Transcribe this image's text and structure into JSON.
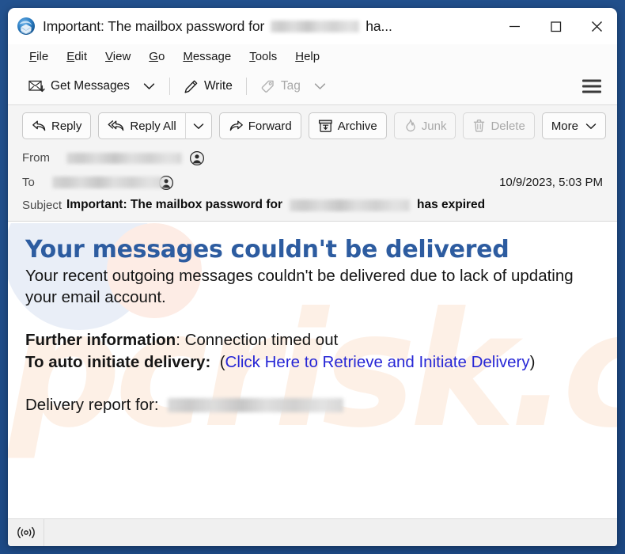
{
  "window": {
    "app_icon": "thunderbird-icon",
    "title_prefix": "Important: The mailbox password for",
    "title_redacted": "[redacted email address]",
    "title_suffix": "ha...",
    "minimize_label": "Minimize",
    "maximize_label": "Maximize",
    "close_label": "Close"
  },
  "menubar": {
    "items": [
      {
        "label": "File",
        "accesskey": "F"
      },
      {
        "label": "Edit",
        "accesskey": "E"
      },
      {
        "label": "View",
        "accesskey": "V"
      },
      {
        "label": "Go",
        "accesskey": "G"
      },
      {
        "label": "Message",
        "accesskey": "M"
      },
      {
        "label": "Tools",
        "accesskey": "T"
      },
      {
        "label": "Help",
        "accesskey": "H"
      }
    ]
  },
  "toolbar": {
    "get_messages_label": "Get Messages",
    "get_messages_icon": "envelope-download-icon",
    "get_messages_dropdown_icon": "chevron-down-icon",
    "write_label": "Write",
    "write_icon": "pencil-icon",
    "tag_label": "Tag",
    "tag_icon": "tag-icon",
    "tag_dropdown_icon": "chevron-down-icon",
    "app_menu_icon": "hamburger-icon"
  },
  "message_actions": {
    "reply_label": "Reply",
    "reply_icon": "reply-arrow-icon",
    "reply_all_label": "Reply All",
    "reply_all_icon": "reply-all-arrow-icon",
    "reply_all_dropdown_icon": "chevron-down-icon",
    "forward_label": "Forward",
    "forward_icon": "forward-arrow-icon",
    "archive_label": "Archive",
    "archive_icon": "archive-box-icon",
    "junk_label": "Junk",
    "junk_icon": "flame-icon",
    "delete_label": "Delete",
    "delete_icon": "trash-icon",
    "more_label": "More",
    "more_dropdown_icon": "chevron-down-icon"
  },
  "headers": {
    "from_label": "From",
    "from_value": "[redacted sender email address]",
    "from_avatar_icon": "contact-avatar-icon",
    "to_label": "To",
    "to_value": "[redacted recipient email address]",
    "to_avatar_icon": "contact-avatar-icon",
    "date": "10/9/2023, 5:03 PM",
    "subject_label": "Subject",
    "subject_prefix": "Important: The mailbox password for",
    "subject_redacted": "[redacted email address]",
    "subject_suffix": "has expired"
  },
  "body": {
    "heading": "Your messages couldn't be delivered",
    "paragraph": "Your recent outgoing messages couldn't be delivered due to lack of updating your email account.",
    "further_info_label": "Further information",
    "further_info_value": ": Connection timed out",
    "auto_initiate_label": "To auto initiate delivery:",
    "link_open_paren": "(",
    "link_text": "Click Here to Retrieve and Initiate Delivery",
    "link_close_paren": ")",
    "delivery_report_label": "Delivery report for:",
    "delivery_report_value": "[redacted email address]",
    "watermark_text": "pcrisk.com",
    "heading_color": "#2d5ca0",
    "link_color": "#2727d6"
  },
  "statusbar": {
    "connection_icon": "broadcast-online-icon"
  }
}
